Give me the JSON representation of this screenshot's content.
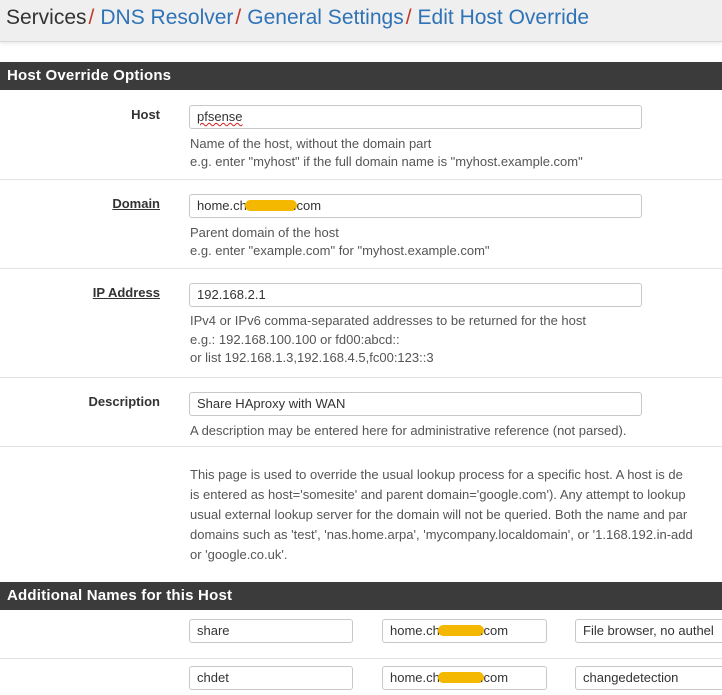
{
  "breadcrumb": {
    "items": [
      "Services",
      "DNS Resolver",
      "General Settings",
      "Edit Host Override"
    ],
    "separator": "/"
  },
  "host_override": {
    "title": "Host Override Options",
    "host": {
      "label": "Host",
      "value": "pfsense",
      "help1": "Name of the host, without the domain part",
      "help2": "e.g. enter \"myhost\" if the full domain name is \"myhost.example.com\""
    },
    "domain": {
      "label": "Domain",
      "value_prefix": "home.ch",
      "value_suffix": ".com",
      "help1": "Parent domain of the host",
      "help2": "e.g. enter \"example.com\" for \"myhost.example.com\""
    },
    "ip": {
      "label": "IP Address",
      "value": "192.168.2.1",
      "help1": "IPv4 or IPv6 comma-separated addresses to be returned for the host",
      "help2": "e.g.: 192.168.100.100 or fd00:abcd::",
      "help3": "or list 192.168.1.3,192.168.4.5,fc00:123::3"
    },
    "description": {
      "label": "Description",
      "value": "Share HAproxy with WAN",
      "help": "A description may be entered here for administrative reference (not parsed)."
    },
    "info": [
      "This page is used to override the usual lookup process for a specific host. A host is de",
      "is entered as host='somesite' and parent domain='google.com'). Any attempt to lookup",
      "usual external lookup server for the domain will not be queried. Both the name and par",
      "domains such as 'test', 'nas.home.arpa', 'mycompany.localdomain', or '1.168.192.in-add",
      "or 'google.co.uk'."
    ]
  },
  "additional": {
    "title": "Additional Names for this Host",
    "rows": [
      {
        "host": "share",
        "domain_prefix": "home.ch",
        "domain_suffix": ".com",
        "description": "File browser, no authel"
      },
      {
        "host": "chdet",
        "domain_prefix": "home.ch",
        "domain_suffix": ".com",
        "description": "changedetection"
      }
    ]
  },
  "colors": {
    "link": "#2f73b7",
    "separator": "#c0392b",
    "panel_heading": "#3b3b3b",
    "redaction": "#f5b800"
  }
}
